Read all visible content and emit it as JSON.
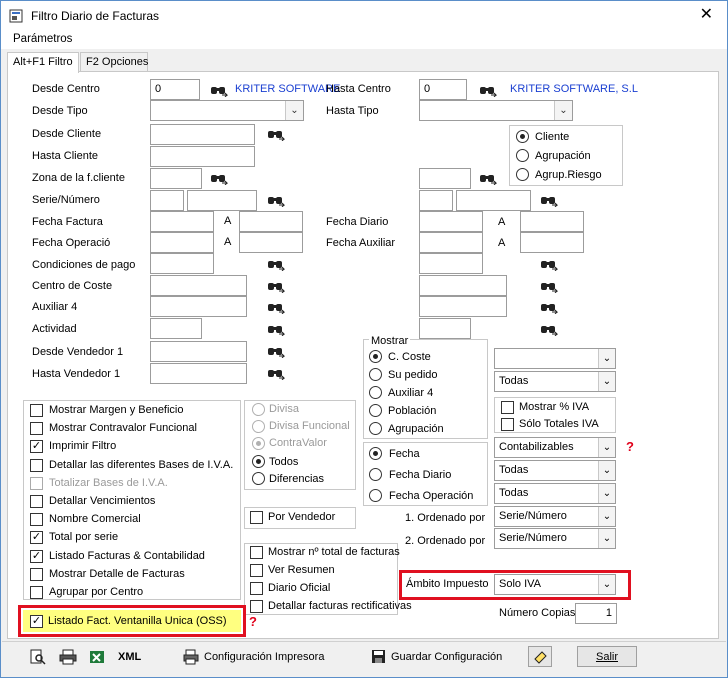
{
  "window": {
    "title": "Filtro Diario de Facturas",
    "close": "✕"
  },
  "menu": {
    "parametros": "Parámetros"
  },
  "tabs": [
    "Alt+F1 Filtro",
    "F2 Opciones"
  ],
  "left": {
    "desde_centro": {
      "label": "Desde Centro",
      "value": "0",
      "name": "KRITER SOFTWARE"
    },
    "desde_tipo": "Desde Tipo",
    "desde_cliente": "Desde Cliente",
    "hasta_cliente": "Hasta Cliente",
    "zona": "Zona de la f.cliente",
    "serie_numero": "Serie/Número",
    "fecha_factura": "Fecha Factura",
    "fecha_operacio": "Fecha Operació",
    "condiciones": "Condiciones de pago",
    "centro_coste": "Centro de Coste",
    "auxiliar4": "Auxiliar 4",
    "actividad": "Actividad",
    "desde_vendedor": "Desde Vendedor 1",
    "hasta_vendedor": "Hasta Vendedor 1",
    "a": "A"
  },
  "right": {
    "hasta_centro": {
      "label": "Hasta Centro",
      "value": "0",
      "name": "KRITER SOFTWARE, S.L"
    },
    "hasta_tipo": "Hasta Tipo",
    "fecha_diario": "Fecha Diario",
    "fecha_auxiliar": "Fecha Auxiliar",
    "a": "A"
  },
  "cliente_group": {
    "options": [
      "Cliente",
      "Agrupación",
      "Agrup.Riesgo"
    ],
    "selected": 0
  },
  "mostrar_group": {
    "title": "Mostrar",
    "options": [
      "C. Coste",
      "Su pedido",
      "Auxiliar 4",
      "Población",
      "Agrupación"
    ],
    "selected": 0
  },
  "fecha_group": {
    "options": [
      "Fecha",
      "Fecha Diario",
      "Fecha Operación"
    ],
    "selected": 0
  },
  "divisa_group": {
    "options": [
      "Divisa",
      "Divisa Funcional",
      "ContraValor"
    ],
    "selected": 2
  },
  "todos_group": {
    "options": [
      "Todos",
      "Diferencias"
    ],
    "selected": 0
  },
  "checks_left": [
    {
      "label": "Mostrar Margen y Beneficio",
      "checked": false,
      "disabled": false
    },
    {
      "label": "Mostrar Contravalor Funcional",
      "checked": false,
      "disabled": false
    },
    {
      "label": "Imprimir Filtro",
      "checked": true,
      "disabled": false
    },
    {
      "label": "Detallar las diferentes Bases de I.V.A.",
      "checked": false,
      "disabled": false
    },
    {
      "label": "Totalizar Bases de I.V.A.",
      "checked": false,
      "disabled": true
    },
    {
      "label": "Detallar Vencimientos",
      "checked": false,
      "disabled": false
    },
    {
      "label": "Nombre Comercial",
      "checked": false,
      "disabled": false
    },
    {
      "label": "Total por serie",
      "checked": true,
      "disabled": false
    },
    {
      "label": "Listado Facturas & Contabilidad",
      "checked": true,
      "disabled": false
    },
    {
      "label": "Mostrar Detalle de Facturas",
      "checked": false,
      "disabled": false
    },
    {
      "label": "Agrupar por Centro",
      "checked": false,
      "disabled": false
    }
  ],
  "oss": {
    "label": "Listado Fact. Ventanilla Unica (OSS)",
    "checked": true
  },
  "checks_mid": [
    {
      "label": "Por Vendedor",
      "checked": false
    },
    {
      "label": "Mostrar nº total de facturas",
      "checked": false
    },
    {
      "label": "Ver Resumen",
      "checked": false
    },
    {
      "label": "Diario Oficial",
      "checked": false
    },
    {
      "label": "Detallar facturas rectificativas",
      "checked": false
    }
  ],
  "checks_right": [
    {
      "label": "Mostrar % IVA",
      "checked": false
    },
    {
      "label": "Sólo Totales IVA",
      "checked": false
    }
  ],
  "combos_right": {
    "combo1": "",
    "combo2": "Todas",
    "contabilizables": "Contabilizables",
    "todas_a": "Todas",
    "todas_b": "Todas"
  },
  "ordenado1": {
    "label": "1. Ordenado por",
    "value": "Serie/Número"
  },
  "ordenado2": {
    "label": "2. Ordenado por",
    "value": "Serie/Número"
  },
  "ambito": {
    "label": "Ámbito Impuesto",
    "value": "Solo IVA"
  },
  "copias": {
    "label": "Número Copias",
    "value": "1"
  },
  "toolbar": {
    "xml": "XML",
    "config_impresora": "Configuración Impresora",
    "guardar": "Guardar Configuración",
    "salir": "Salir"
  },
  "colors": {
    "highlight_red": "#e01020",
    "link_blue": "#1a3fd1",
    "oss_yellow": "#ffff80"
  }
}
